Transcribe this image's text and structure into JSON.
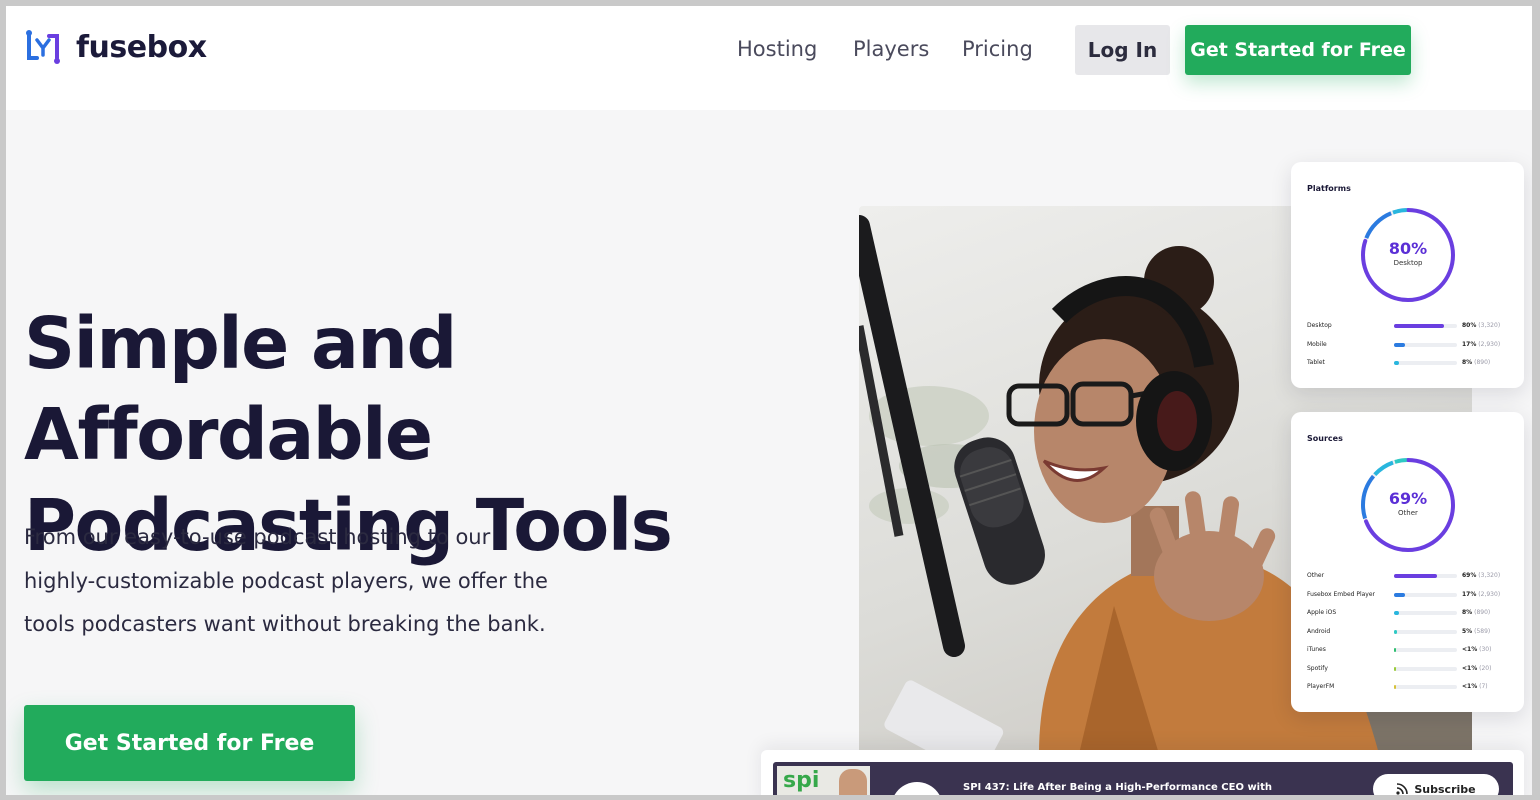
{
  "header": {
    "brand": "fusebox",
    "nav": [
      "Hosting",
      "Players",
      "Pricing"
    ],
    "login_label": "Log In",
    "cta_label": "Get Started for Free"
  },
  "hero": {
    "title_line1": "Simple and Affordable",
    "title_line2": "Podcasting Tools",
    "description_lines": [
      "From our easy-to-use podcast hosting to our",
      "highly-customizable podcast players, we offer the",
      "tools podcasters want without breaking the bank."
    ],
    "cta_label": "Get Started for Free"
  },
  "platforms_card": {
    "title": "Platforms",
    "ring_value": "80%",
    "ring_label": "Desktop",
    "rows": [
      {
        "label": "Desktop",
        "pct": "80%",
        "count": "(3,320)",
        "fraction": 0.8,
        "color": "#6a3ee0"
      },
      {
        "label": "Mobile",
        "pct": "17%",
        "count": "(2,930)",
        "fraction": 0.17,
        "color": "#2b7be0"
      },
      {
        "label": "Tablet",
        "pct": "8%",
        "count": "(890)",
        "fraction": 0.08,
        "color": "#29b6de"
      }
    ]
  },
  "sources_card": {
    "title": "Sources",
    "ring_value": "69%",
    "ring_label": "Other",
    "rows": [
      {
        "label": "Other",
        "pct": "69%",
        "count": "(3,320)",
        "fraction": 0.69,
        "color": "#6a3ee0"
      },
      {
        "label": "Fusebox Embed Player",
        "pct": "17%",
        "count": "(2,930)",
        "fraction": 0.17,
        "color": "#2b7be0"
      },
      {
        "label": "Apple iOS",
        "pct": "8%",
        "count": "(890)",
        "fraction": 0.08,
        "color": "#29b6de"
      },
      {
        "label": "Android",
        "pct": "5%",
        "count": "(589)",
        "fraction": 0.05,
        "color": "#2ec9c4"
      },
      {
        "label": "iTunes",
        "pct": "<1%",
        "count": "(30)",
        "fraction": 0.02,
        "color": "#2fbf71"
      },
      {
        "label": "Spotify",
        "pct": "<1%",
        "count": "(20)",
        "fraction": 0.015,
        "color": "#9acb3a"
      },
      {
        "label": "PlayerFM",
        "pct": "<1%",
        "count": "(7)",
        "fraction": 0.01,
        "color": "#d6c23a"
      }
    ]
  },
  "player": {
    "thumb_logo": "spi",
    "episode_title": "SPI 437: Life After Being a High-Performance CEO with",
    "subscribe_label": "Subscribe"
  },
  "colors": {
    "accent_green": "#22ab5c",
    "heading": "#1a1836",
    "brand_purple": "#5b2fd6"
  },
  "icons": [
    "fusebox-logo-icon",
    "rss-icon"
  ]
}
